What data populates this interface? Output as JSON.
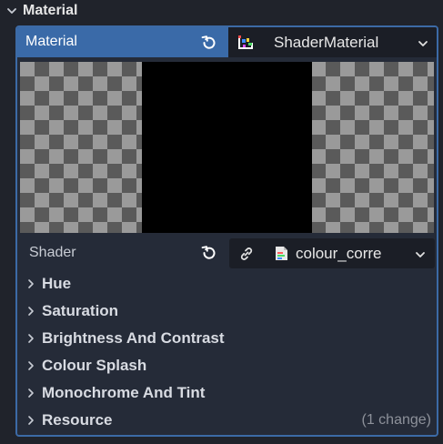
{
  "section": {
    "title": "Material"
  },
  "material": {
    "label": "Material",
    "resource_name": "ShaderMaterial"
  },
  "shader": {
    "label": "Shader",
    "resource_name": "colour_corre"
  },
  "properties": [
    {
      "label": "Hue"
    },
    {
      "label": "Saturation"
    },
    {
      "label": "Brightness And Contrast"
    },
    {
      "label": "Colour Splash"
    },
    {
      "label": "Monochrome And Tint"
    },
    {
      "label": "Resource",
      "changes": "(1 change)"
    }
  ],
  "colors": {
    "accent": "#3a6aa8",
    "panel_bg": "#252b38",
    "picker_bg": "#1b1e26",
    "checker_dark": "#5a5a5a",
    "checker_light": "#9a9a9a"
  },
  "icons": {
    "section_toggle": "chevron-down-icon",
    "revert": "revert-icon",
    "shader_material": "shader-material-icon",
    "dropdown": "chevron-down-icon",
    "make_unique": "link-icon",
    "shader_file": "shader-file-icon",
    "expand": "chevron-right-icon"
  }
}
